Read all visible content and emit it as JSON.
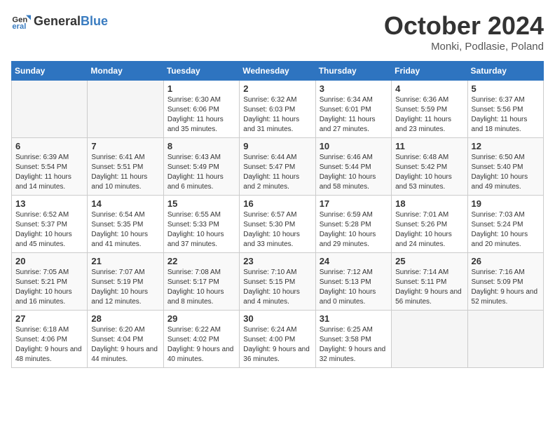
{
  "header": {
    "logo_general": "General",
    "logo_blue": "Blue",
    "month": "October 2024",
    "location": "Monki, Podlasie, Poland"
  },
  "weekdays": [
    "Sunday",
    "Monday",
    "Tuesday",
    "Wednesday",
    "Thursday",
    "Friday",
    "Saturday"
  ],
  "weeks": [
    [
      {
        "day": "",
        "empty": true
      },
      {
        "day": "",
        "empty": true
      },
      {
        "day": "1",
        "sunrise": "Sunrise: 6:30 AM",
        "sunset": "Sunset: 6:06 PM",
        "daylight": "Daylight: 11 hours and 35 minutes."
      },
      {
        "day": "2",
        "sunrise": "Sunrise: 6:32 AM",
        "sunset": "Sunset: 6:03 PM",
        "daylight": "Daylight: 11 hours and 31 minutes."
      },
      {
        "day": "3",
        "sunrise": "Sunrise: 6:34 AM",
        "sunset": "Sunset: 6:01 PM",
        "daylight": "Daylight: 11 hours and 27 minutes."
      },
      {
        "day": "4",
        "sunrise": "Sunrise: 6:36 AM",
        "sunset": "Sunset: 5:59 PM",
        "daylight": "Daylight: 11 hours and 23 minutes."
      },
      {
        "day": "5",
        "sunrise": "Sunrise: 6:37 AM",
        "sunset": "Sunset: 5:56 PM",
        "daylight": "Daylight: 11 hours and 18 minutes."
      }
    ],
    [
      {
        "day": "6",
        "sunrise": "Sunrise: 6:39 AM",
        "sunset": "Sunset: 5:54 PM",
        "daylight": "Daylight: 11 hours and 14 minutes."
      },
      {
        "day": "7",
        "sunrise": "Sunrise: 6:41 AM",
        "sunset": "Sunset: 5:51 PM",
        "daylight": "Daylight: 11 hours and 10 minutes."
      },
      {
        "day": "8",
        "sunrise": "Sunrise: 6:43 AM",
        "sunset": "Sunset: 5:49 PM",
        "daylight": "Daylight: 11 hours and 6 minutes."
      },
      {
        "day": "9",
        "sunrise": "Sunrise: 6:44 AM",
        "sunset": "Sunset: 5:47 PM",
        "daylight": "Daylight: 11 hours and 2 minutes."
      },
      {
        "day": "10",
        "sunrise": "Sunrise: 6:46 AM",
        "sunset": "Sunset: 5:44 PM",
        "daylight": "Daylight: 10 hours and 58 minutes."
      },
      {
        "day": "11",
        "sunrise": "Sunrise: 6:48 AM",
        "sunset": "Sunset: 5:42 PM",
        "daylight": "Daylight: 10 hours and 53 minutes."
      },
      {
        "day": "12",
        "sunrise": "Sunrise: 6:50 AM",
        "sunset": "Sunset: 5:40 PM",
        "daylight": "Daylight: 10 hours and 49 minutes."
      }
    ],
    [
      {
        "day": "13",
        "sunrise": "Sunrise: 6:52 AM",
        "sunset": "Sunset: 5:37 PM",
        "daylight": "Daylight: 10 hours and 45 minutes."
      },
      {
        "day": "14",
        "sunrise": "Sunrise: 6:54 AM",
        "sunset": "Sunset: 5:35 PM",
        "daylight": "Daylight: 10 hours and 41 minutes."
      },
      {
        "day": "15",
        "sunrise": "Sunrise: 6:55 AM",
        "sunset": "Sunset: 5:33 PM",
        "daylight": "Daylight: 10 hours and 37 minutes."
      },
      {
        "day": "16",
        "sunrise": "Sunrise: 6:57 AM",
        "sunset": "Sunset: 5:30 PM",
        "daylight": "Daylight: 10 hours and 33 minutes."
      },
      {
        "day": "17",
        "sunrise": "Sunrise: 6:59 AM",
        "sunset": "Sunset: 5:28 PM",
        "daylight": "Daylight: 10 hours and 29 minutes."
      },
      {
        "day": "18",
        "sunrise": "Sunrise: 7:01 AM",
        "sunset": "Sunset: 5:26 PM",
        "daylight": "Daylight: 10 hours and 24 minutes."
      },
      {
        "day": "19",
        "sunrise": "Sunrise: 7:03 AM",
        "sunset": "Sunset: 5:24 PM",
        "daylight": "Daylight: 10 hours and 20 minutes."
      }
    ],
    [
      {
        "day": "20",
        "sunrise": "Sunrise: 7:05 AM",
        "sunset": "Sunset: 5:21 PM",
        "daylight": "Daylight: 10 hours and 16 minutes."
      },
      {
        "day": "21",
        "sunrise": "Sunrise: 7:07 AM",
        "sunset": "Sunset: 5:19 PM",
        "daylight": "Daylight: 10 hours and 12 minutes."
      },
      {
        "day": "22",
        "sunrise": "Sunrise: 7:08 AM",
        "sunset": "Sunset: 5:17 PM",
        "daylight": "Daylight: 10 hours and 8 minutes."
      },
      {
        "day": "23",
        "sunrise": "Sunrise: 7:10 AM",
        "sunset": "Sunset: 5:15 PM",
        "daylight": "Daylight: 10 hours and 4 minutes."
      },
      {
        "day": "24",
        "sunrise": "Sunrise: 7:12 AM",
        "sunset": "Sunset: 5:13 PM",
        "daylight": "Daylight: 10 hours and 0 minutes."
      },
      {
        "day": "25",
        "sunrise": "Sunrise: 7:14 AM",
        "sunset": "Sunset: 5:11 PM",
        "daylight": "Daylight: 9 hours and 56 minutes."
      },
      {
        "day": "26",
        "sunrise": "Sunrise: 7:16 AM",
        "sunset": "Sunset: 5:09 PM",
        "daylight": "Daylight: 9 hours and 52 minutes."
      }
    ],
    [
      {
        "day": "27",
        "sunrise": "Sunrise: 6:18 AM",
        "sunset": "Sunset: 4:06 PM",
        "daylight": "Daylight: 9 hours and 48 minutes."
      },
      {
        "day": "28",
        "sunrise": "Sunrise: 6:20 AM",
        "sunset": "Sunset: 4:04 PM",
        "daylight": "Daylight: 9 hours and 44 minutes."
      },
      {
        "day": "29",
        "sunrise": "Sunrise: 6:22 AM",
        "sunset": "Sunset: 4:02 PM",
        "daylight": "Daylight: 9 hours and 40 minutes."
      },
      {
        "day": "30",
        "sunrise": "Sunrise: 6:24 AM",
        "sunset": "Sunset: 4:00 PM",
        "daylight": "Daylight: 9 hours and 36 minutes."
      },
      {
        "day": "31",
        "sunrise": "Sunrise: 6:25 AM",
        "sunset": "Sunset: 3:58 PM",
        "daylight": "Daylight: 9 hours and 32 minutes."
      },
      {
        "day": "",
        "empty": true
      },
      {
        "day": "",
        "empty": true
      }
    ]
  ]
}
